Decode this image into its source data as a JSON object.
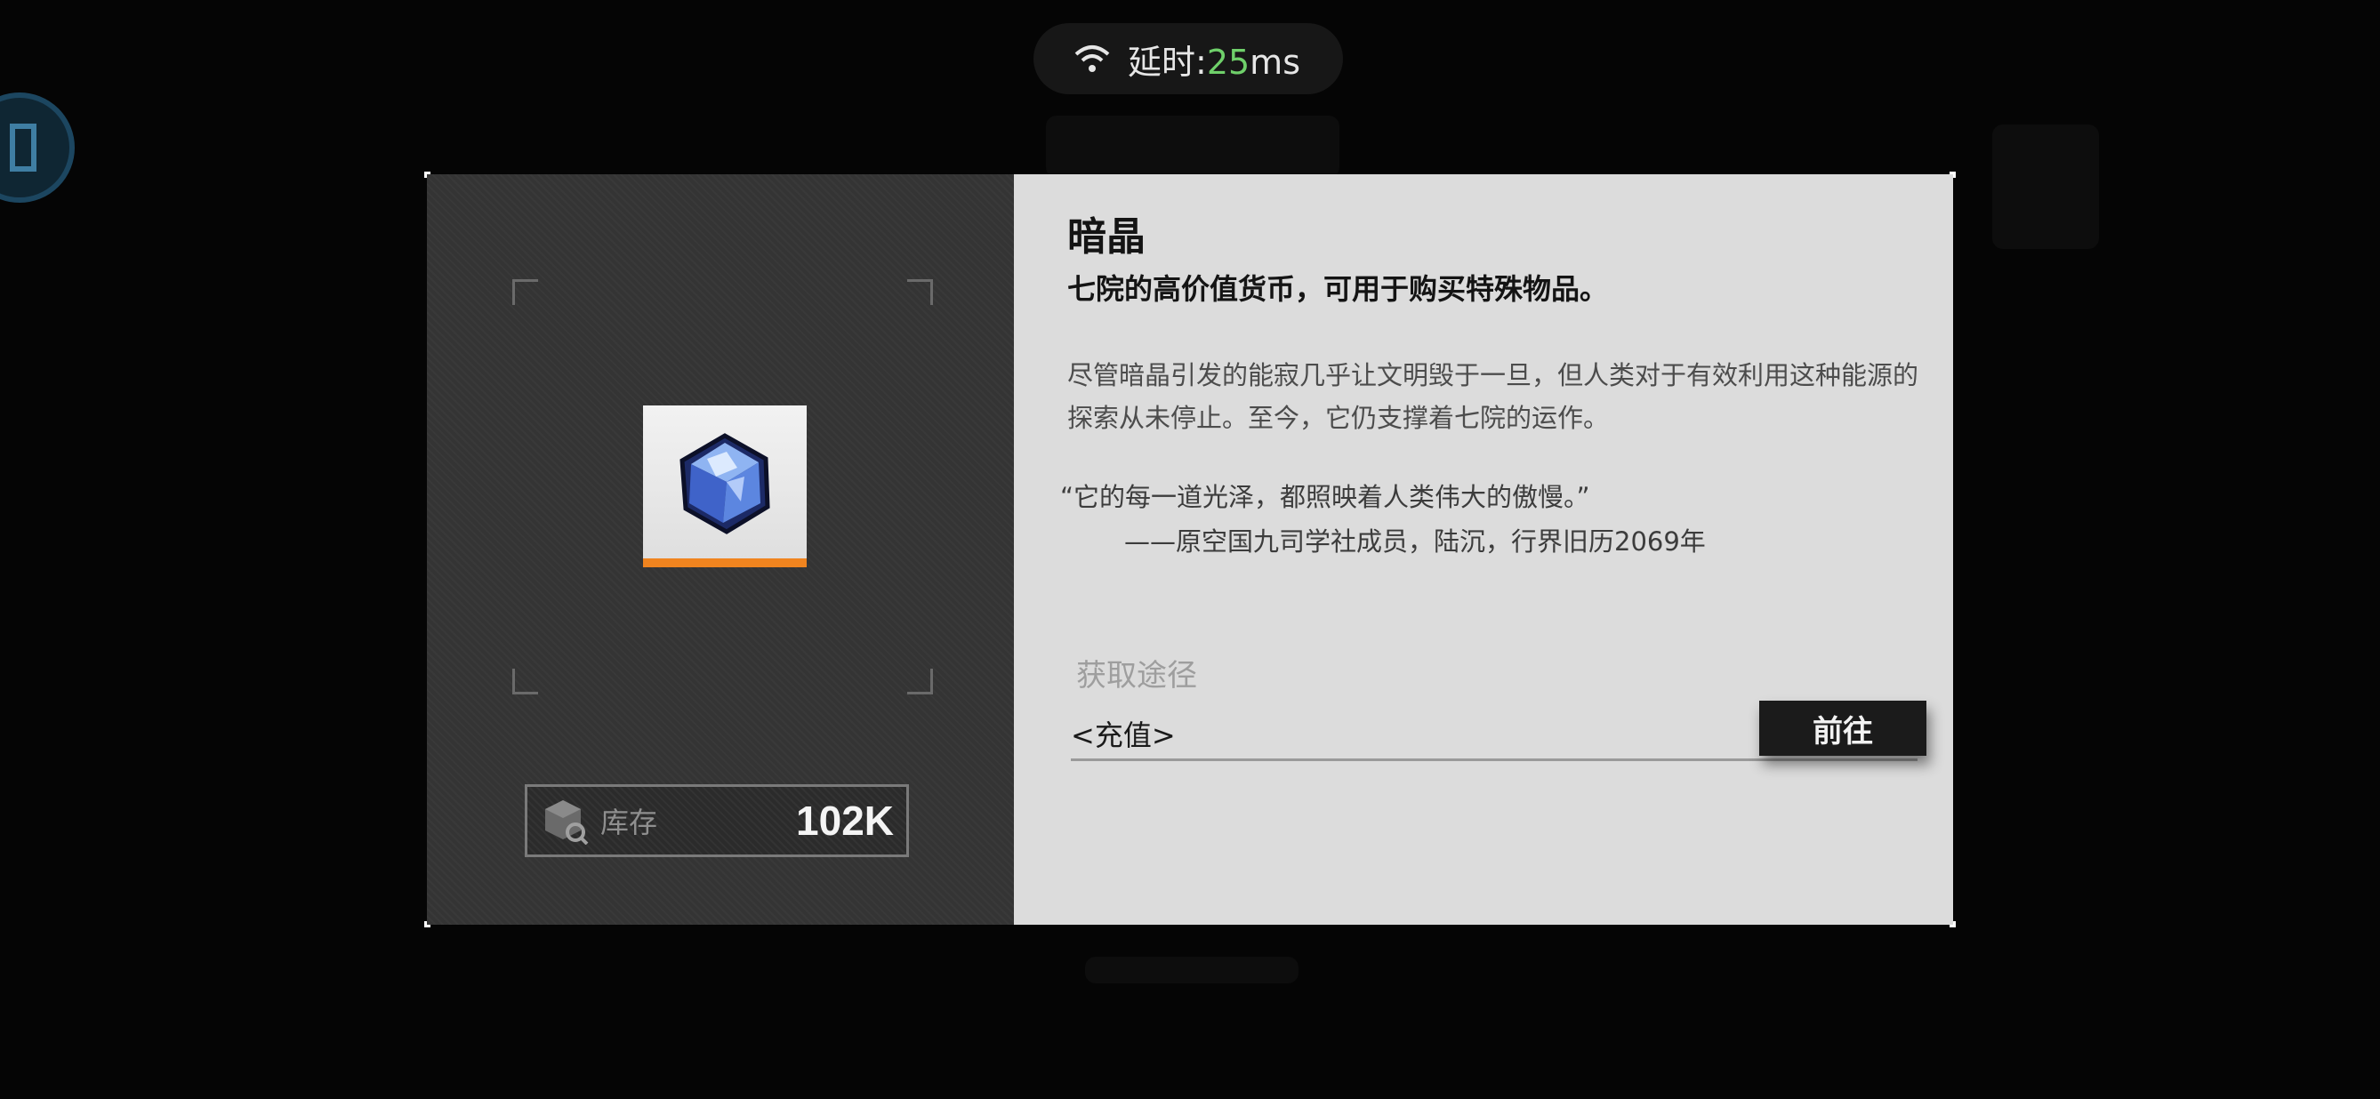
{
  "status_bar": {
    "latency_label": "延时:",
    "latency_value": "25",
    "latency_unit": "ms",
    "accent_color": "#6fd06a"
  },
  "item": {
    "name": "暗晶",
    "subtitle": "七院的高价值货币，可用于购买特殊物品。",
    "description": "尽管暗晶引发的能寂几乎让文明毁于一旦，但人类对于有效利用这种能源的探索从未停止。至今，它仍支撑着七院的运作。",
    "quote": "“它的每一道光泽，都照映着人类伟大的傲慢。”",
    "quote_author": "——原空国九司学社成员，陆沉，行界旧历2069年",
    "rarity_color": "#f0841f",
    "icon": "crystal-icon"
  },
  "stock": {
    "label": "库存",
    "count": "102K",
    "icon": "box-search-icon"
  },
  "sources": {
    "heading": "获取途径",
    "items": [
      {
        "name": "<充值>",
        "button_label": "前往"
      }
    ]
  }
}
